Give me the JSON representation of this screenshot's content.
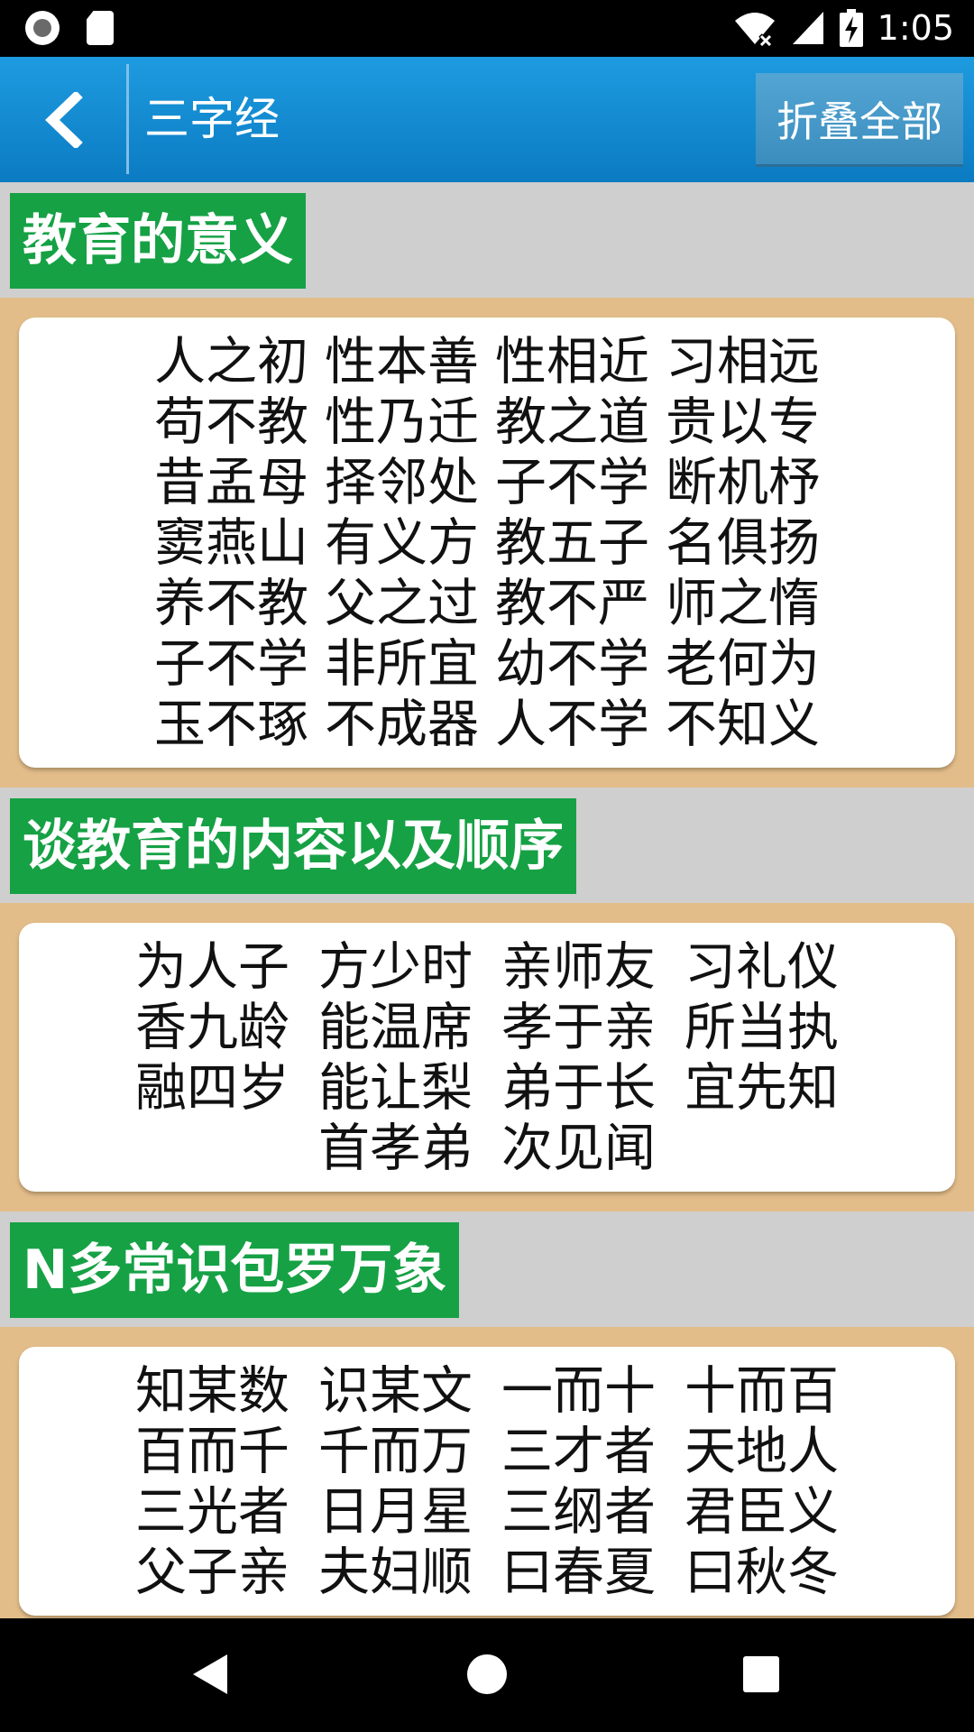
{
  "status_bar": {
    "time": "1:05",
    "icons": [
      "notification-circle-icon",
      "sd-card-icon",
      "wifi-off-icon",
      "cell-signal-icon",
      "battery-charging-icon"
    ]
  },
  "app_bar": {
    "title": "三字经",
    "collapse_label": "折叠全部",
    "back_icon": "chevron-left-icon"
  },
  "sections": [
    {
      "title": "教育的意义",
      "lines": [
        [
          "人之初",
          "性本善",
          "性相近",
          "习相远"
        ],
        [
          "苟不教",
          "性乃迁",
          "教之道",
          "贵以专"
        ],
        [
          "昔孟母",
          "择邻处",
          "子不学",
          "断机杼"
        ],
        [
          "窦燕山",
          "有义方",
          "教五子",
          "名俱扬"
        ],
        [
          "养不教",
          "父之过",
          "教不严",
          "师之惰"
        ],
        [
          "子不学",
          "非所宜",
          "幼不学",
          "老何为"
        ],
        [
          "玉不琢",
          "不成器",
          "人不学",
          "不知义"
        ]
      ]
    },
    {
      "title": "谈教育的内容以及顺序",
      "lines": [
        [
          "为人子",
          "方少时",
          "亲师友",
          "习礼仪"
        ],
        [
          "香九龄",
          "能温席",
          "孝于亲",
          "所当执"
        ],
        [
          "融四岁",
          "能让梨",
          "弟于长",
          "宜先知"
        ],
        [
          "",
          "首孝弟",
          "次见闻",
          ""
        ]
      ]
    },
    {
      "title": "N多常识包罗万象",
      "lines": [
        [
          "知某数",
          "识某文",
          "一而十",
          "十而百"
        ],
        [
          "百而千",
          "千而万",
          "三才者",
          "天地人"
        ],
        [
          "三光者",
          "日月星",
          "三纲者",
          "君臣义"
        ],
        [
          "父子亲",
          "夫妇顺",
          "曰春夏",
          "曰秋冬"
        ]
      ]
    }
  ],
  "nav_bar": {
    "icons": [
      "nav-back-icon",
      "nav-home-icon",
      "nav-recent-icon"
    ]
  }
}
